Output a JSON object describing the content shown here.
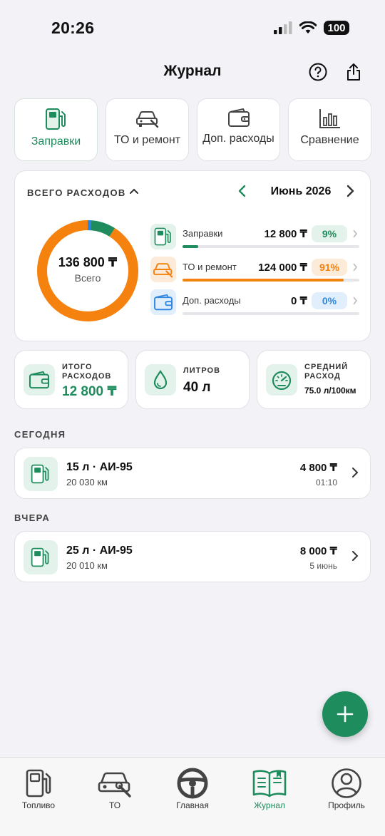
{
  "status": {
    "time": "20:26",
    "battery": "100"
  },
  "header": {
    "title": "Журнал"
  },
  "categories": [
    {
      "label": "Заправки",
      "icon": "fuel-pump-icon",
      "active": true
    },
    {
      "label": "ТО и ремонт",
      "icon": "car-repair-icon",
      "active": false
    },
    {
      "label": "Доп. расходы",
      "icon": "wallet-icon",
      "active": false
    },
    {
      "label": "Сравнение",
      "icon": "bar-chart-icon",
      "active": false
    }
  ],
  "summary": {
    "header": "ВСЕГО РАСХОДОВ",
    "month": "Июнь 2026",
    "total_value": "136 800 ₸",
    "total_label": "Всего",
    "rows": [
      {
        "label": "Заправки",
        "amount": "12 800 ₸",
        "percent": "9%",
        "share": 0.09,
        "color": "#1E8C5C",
        "pill_bg": "#E3F2EA",
        "pill_fg": "#1E8C5C"
      },
      {
        "label": "ТО и ремонт",
        "amount": "124 000 ₸",
        "percent": "91%",
        "share": 0.91,
        "color": "#F5820F",
        "pill_bg": "#FDEBD9",
        "pill_fg": "#F5820F"
      },
      {
        "label": "Доп. расходы",
        "amount": "0 ₸",
        "percent": "0%",
        "share": 0.0,
        "color": "#2F86E0",
        "pill_bg": "#E1EEFB",
        "pill_fg": "#2F86E0"
      }
    ]
  },
  "stats": [
    {
      "label": "ИТОГО РАСХОДОВ",
      "value": "12 800 ₸",
      "icon": "wallet-icon"
    },
    {
      "label": "ЛИТРОВ",
      "value": "40 л",
      "icon": "drop-icon"
    },
    {
      "label": "СРЕДНИЙ РАСХОД",
      "value": "75.0 л/100км",
      "icon": "speedometer-icon"
    }
  ],
  "sections": [
    {
      "title": "СЕГОДНЯ",
      "entries": [
        {
          "title": "15 л · АИ-95",
          "odometer": "20 030 км",
          "amount": "4 800 ₸",
          "time": "01:10"
        }
      ]
    },
    {
      "title": "ВЧЕРА",
      "entries": [
        {
          "title": "25 л · АИ-95",
          "odometer": "20 010 км",
          "amount": "8 000 ₸",
          "time": "5 июнь"
        }
      ]
    }
  ],
  "tabs": [
    {
      "label": "Топливо",
      "icon": "fuel-pump-icon"
    },
    {
      "label": "ТО",
      "icon": "car-repair-icon"
    },
    {
      "label": "Главная",
      "icon": "steering-wheel-icon"
    },
    {
      "label": "Журнал",
      "icon": "journal-book-icon",
      "active": true
    },
    {
      "label": "Профиль",
      "icon": "profile-icon"
    }
  ],
  "colors": {
    "accent": "#1E8C5C",
    "orange": "#F5820F",
    "blue": "#2F86E0"
  }
}
